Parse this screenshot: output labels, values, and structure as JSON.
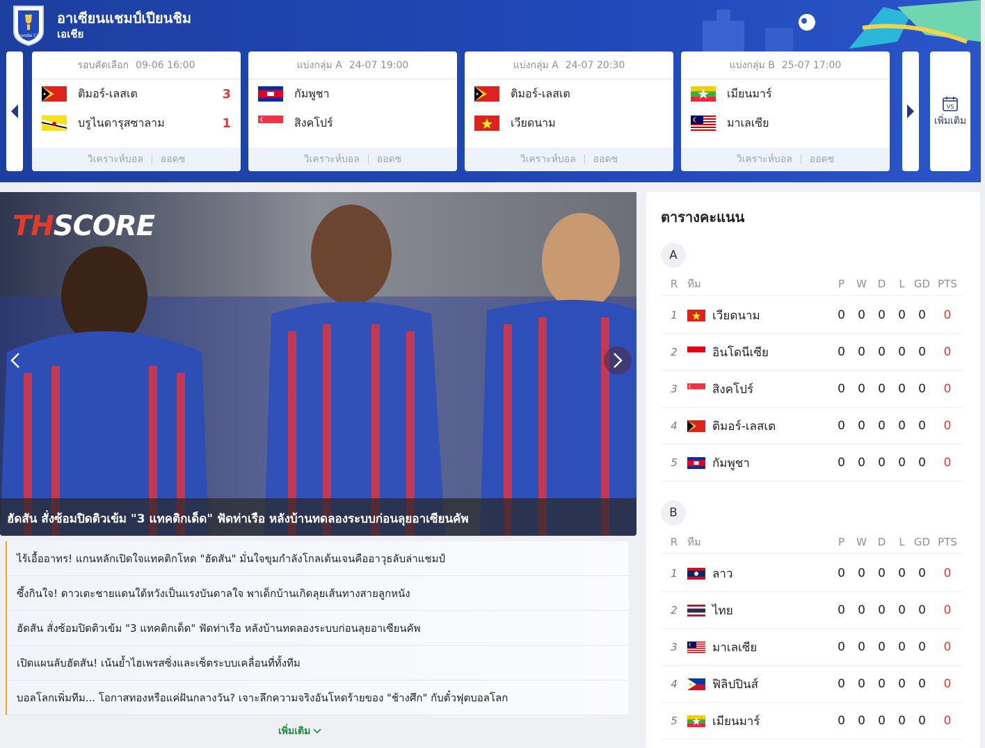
{
  "header": {
    "title": "อาเซียนแชมป์เปียนชิม",
    "subtitle": "เอเชีย",
    "logo_text": "Hyundai CUP",
    "more_label": "เพิ่มเติม",
    "more_icon": "vs-calendar-icon"
  },
  "matches": [
    {
      "round": "รอบคัดเลือก",
      "datetime": "09-06 16:00",
      "home": {
        "name": "ติมอร์-เลสเต",
        "flag": "timor-leste-flag",
        "score": "3"
      },
      "away": {
        "name": "บรูไนดารุสซาลาม",
        "flag": "brunei-flag",
        "score": "1"
      },
      "analysis": "วิเคราะห์บอล",
      "odds": "ออดซ"
    },
    {
      "round": "แบ่งกลุ่ม A",
      "datetime": "24-07 19:00",
      "home": {
        "name": "กัมพูชา",
        "flag": "cambodia-flag",
        "score": ""
      },
      "away": {
        "name": "สิงคโปร์",
        "flag": "singapore-flag",
        "score": ""
      },
      "analysis": "วิเคราะห์บอล",
      "odds": "ออดซ"
    },
    {
      "round": "แบ่งกลุ่ม A",
      "datetime": "24-07 20:30",
      "home": {
        "name": "ติมอร์-เลสเต",
        "flag": "timor-leste-flag",
        "score": ""
      },
      "away": {
        "name": "เวียดนาม",
        "flag": "vietnam-flag",
        "score": ""
      },
      "analysis": "วิเคราะห์บอล",
      "odds": "ออดซ"
    },
    {
      "round": "แบ่งกลุ่ม B",
      "datetime": "25-07 17:00",
      "home": {
        "name": "เมียนมาร์",
        "flag": "myanmar-flag",
        "score": ""
      },
      "away": {
        "name": "มาเลเซีย",
        "flag": "malaysia-flag",
        "score": ""
      },
      "analysis": "วิเคราะห์บอล",
      "odds": "ออดซ"
    }
  ],
  "hero": {
    "brand_th": "TH",
    "brand_score": "SCORE",
    "caption": "ฮัดสัน สั่งซ้อมปิดติวเข้ม \"3 แทคติกเด็ด\" ฟัดท่าเรือ หลังบ้านทดลองระบบก่อนลุยอาเซียนคัพ"
  },
  "news": [
    "ไร้เอื้ออาทร! แกนหลักเปิดใจแทคติกโหด \"ฮัดสัน\" มั่นใจขุมกำลังโกลเด้นเจนคืออาวุธลับล่าแชมป์",
    "ซึ้งกินใจ! ดาวเตะชายแดนใต้หวังเป็นแรงบันดาลใจ พาเด็กบ้านเกิดลุยเส้นทางสายลูกหนัง",
    "ฮัดสัน สั่งซ้อมปิดติวเข้ม \"3 แทคติกเด็ด\" ฟัดท่าเรือ หลังบ้านทดลองระบบก่อนลุยอาเซียนคัพ",
    "เปิดแผนลับฮัดสัน! เน้นย้ำไฮเพรสซิ่งและเซ็ตระบบเคลื่อนที่ทั้งทีม",
    "บอลโลกเพิ่มทีม... โอกาสทองหรือแค่ฝันกลางวัน? เจาะลึกความจริงอันโหดร้ายของ \"ช้างศึก\" กับตั๋วฟุตบอลโลก"
  ],
  "news_more": "เพิ่มเติม",
  "standings": {
    "title": "ตารางคะแนน",
    "columns": {
      "r": "R",
      "team": "ทีม",
      "p": "P",
      "w": "W",
      "d": "D",
      "l": "L",
      "gd": "GD",
      "pts": "PTS"
    },
    "groups": [
      {
        "name": "A",
        "rows": [
          {
            "rank": "1",
            "team": "เวียดนาม",
            "flag": "vietnam-flag",
            "p": "0",
            "w": "0",
            "d": "0",
            "l": "0",
            "gd": "0",
            "pts": "0"
          },
          {
            "rank": "2",
            "team": "อินโดนีเซีย",
            "flag": "indonesia-flag",
            "p": "0",
            "w": "0",
            "d": "0",
            "l": "0",
            "gd": "0",
            "pts": "0"
          },
          {
            "rank": "3",
            "team": "สิงคโปร์",
            "flag": "singapore-flag",
            "p": "0",
            "w": "0",
            "d": "0",
            "l": "0",
            "gd": "0",
            "pts": "0"
          },
          {
            "rank": "4",
            "team": "ติมอร์-เลสเต",
            "flag": "timor-leste-flag",
            "p": "0",
            "w": "0",
            "d": "0",
            "l": "0",
            "gd": "0",
            "pts": "0"
          },
          {
            "rank": "5",
            "team": "กัมพูชา",
            "flag": "cambodia-flag",
            "p": "0",
            "w": "0",
            "d": "0",
            "l": "0",
            "gd": "0",
            "pts": "0"
          }
        ]
      },
      {
        "name": "B",
        "rows": [
          {
            "rank": "1",
            "team": "ลาว",
            "flag": "laos-flag",
            "p": "0",
            "w": "0",
            "d": "0",
            "l": "0",
            "gd": "0",
            "pts": "0"
          },
          {
            "rank": "2",
            "team": "ไทย",
            "flag": "thailand-flag",
            "p": "0",
            "w": "0",
            "d": "0",
            "l": "0",
            "gd": "0",
            "pts": "0"
          },
          {
            "rank": "3",
            "team": "มาเลเซีย",
            "flag": "malaysia-flag",
            "p": "0",
            "w": "0",
            "d": "0",
            "l": "0",
            "gd": "0",
            "pts": "0"
          },
          {
            "rank": "4",
            "team": "ฟิลิปปินส์",
            "flag": "philippines-flag",
            "p": "0",
            "w": "0",
            "d": "0",
            "l": "0",
            "gd": "0",
            "pts": "0"
          },
          {
            "rank": "5",
            "team": "เมียนมาร์",
            "flag": "myanmar-flag",
            "p": "0",
            "w": "0",
            "d": "0",
            "l": "0",
            "gd": "0",
            "pts": "0"
          }
        ]
      }
    ]
  },
  "colors": {
    "banner": "#2148b8",
    "score_red": "#e03a3a",
    "news_accent": "#f2a12a",
    "more_green": "#1a8a3a"
  }
}
